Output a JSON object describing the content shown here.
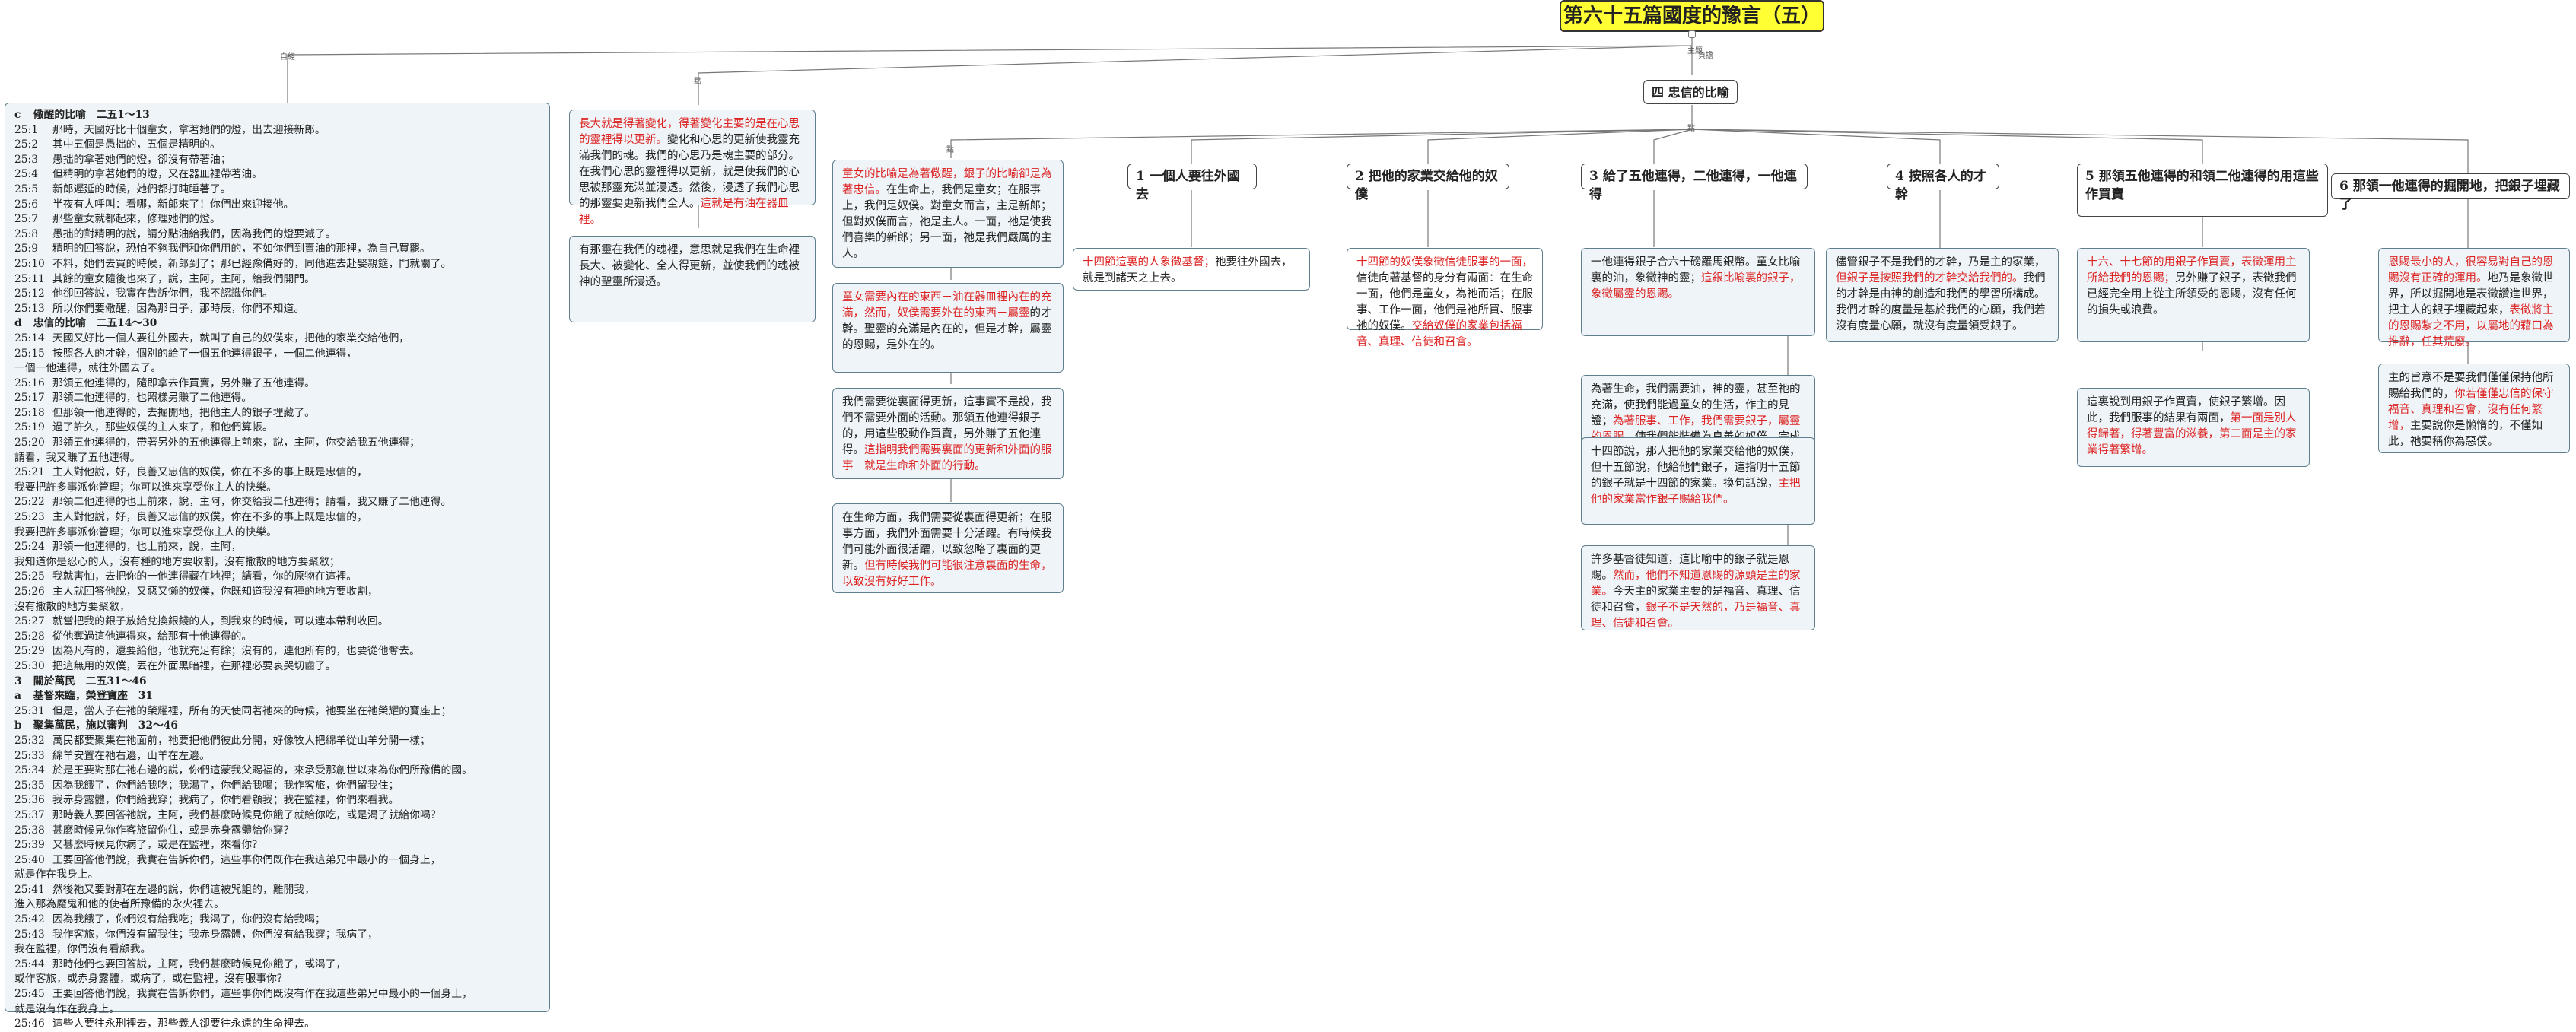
{
  "root": {
    "title": "第六十五篇國度的豫言（五）"
  },
  "labels": {
    "top_connector": "主題",
    "left_branch": "自經",
    "mid_branch": "點",
    "right_branch": "負擔",
    "sub_branch": "點",
    "item_point": "點"
  },
  "scripture": {
    "lines": [
      {
        "t": "h",
        "ref": "c",
        "text": "  儆醒的比喻　二五1～13"
      },
      {
        "t": "v",
        "ref": "25:1",
        "text": "那時，天國好比十個童女，拿著她們的燈，出去迎接新郎。"
      },
      {
        "t": "v",
        "ref": "25:2",
        "text": "其中五個是愚拙的，五個是精明的。"
      },
      {
        "t": "v",
        "ref": "25:3",
        "text": "愚拙的拿著她們的燈，卻沒有帶著油；"
      },
      {
        "t": "v",
        "ref": "25:4",
        "text": "但精明的拿著她們的燈，又在器皿裡帶著油。"
      },
      {
        "t": "v",
        "ref": "25:5",
        "text": "新郎遲延的時候，她們都打盹睡著了。"
      },
      {
        "t": "v",
        "ref": "25:6",
        "text": "半夜有人呼叫：看哪，新郎來了！你們出來迎接他。"
      },
      {
        "t": "v",
        "ref": "25:7",
        "text": "那些童女就都起來，修理她們的燈。"
      },
      {
        "t": "v",
        "ref": "25:8",
        "text": "愚拙的對精明的說，請分點油給我們，因為我們的燈要滅了。"
      },
      {
        "t": "v",
        "ref": "25:9",
        "text": "精明的回答說，恐怕不夠我們和你們用的，不如你們到賣油的那裡，為自己買罷。"
      },
      {
        "t": "v",
        "ref": "25:10",
        "text": "不料，她們去買的時候，新郎到了；那已經豫備好的，同他進去赴娶親筵，門就關了。"
      },
      {
        "t": "v",
        "ref": "25:11",
        "text": "其餘的童女隨後也來了，說，主阿，主阿，給我們開門。"
      },
      {
        "t": "v",
        "ref": "25:12",
        "text": "他卻回答說，我實在告訴你們，我不認識你們。"
      },
      {
        "t": "v",
        "ref": "25:13",
        "text": "所以你們要儆醒，因為那日子，那時辰，你們不知道。"
      },
      {
        "t": "h",
        "ref": "d",
        "text": "  忠信的比喻　二五14～30"
      },
      {
        "t": "v",
        "ref": "25:14",
        "text": "天國又好比一個人要往外國去，就叫了自己的奴僕來，把他的家業交給他們，"
      },
      {
        "t": "v",
        "ref": "25:15",
        "text": "按照各人的才幹，個別的給了一個五他連得銀子，一個二他連得，"
      },
      {
        "t": "c",
        "ref": "",
        "text": "一個一他連得，就往外國去了。"
      },
      {
        "t": "v",
        "ref": "25:16",
        "text": "那領五他連得的，隨即拿去作買賣，另外賺了五他連得。"
      },
      {
        "t": "v",
        "ref": "25:17",
        "text": "那領二他連得的，也照樣另賺了二他連得。"
      },
      {
        "t": "v",
        "ref": "25:18",
        "text": "但那領一他連得的，去掘開地，把他主人的銀子埋藏了。"
      },
      {
        "t": "v",
        "ref": "25:19",
        "text": "過了許久，那些奴僕的主人來了，和他們算帳。"
      },
      {
        "t": "v",
        "ref": "25:20",
        "text": "那領五他連得的，帶著另外的五他連得上前來，說，主阿，你交給我五他連得；"
      },
      {
        "t": "c",
        "ref": "",
        "text": "請看，我又賺了五他連得。"
      },
      {
        "t": "v",
        "ref": "25:21",
        "text": "主人對他說，好，良善又忠信的奴僕，你在不多的事上既是忠信的，"
      },
      {
        "t": "c",
        "ref": "",
        "text": "我要把許多事派你管理；你可以進來享受你主人的快樂。"
      },
      {
        "t": "v",
        "ref": "25:22",
        "text": "那領二他連得的也上前來，說，主阿，你交給我二他連得；請看，我又賺了二他連得。"
      },
      {
        "t": "v",
        "ref": "25:23",
        "text": "主人對他說，好，良善又忠信的奴僕，你在不多的事上既是忠信的，"
      },
      {
        "t": "c",
        "ref": "",
        "text": "我要把許多事派你管理；你可以進來享受你主人的快樂。"
      },
      {
        "t": "v",
        "ref": "25:24",
        "text": "那領一他連得的，也上前來，說，主阿，"
      },
      {
        "t": "c",
        "ref": "",
        "text": "我知道你是忍心的人，沒有種的地方要收割，沒有撒散的地方要聚斂；"
      },
      {
        "t": "v",
        "ref": "25:25",
        "text": "我就害怕，去把你的一他連得藏在地裡；請看，你的原物在這裡。"
      },
      {
        "t": "v",
        "ref": "25:26",
        "text": "主人就回答他說，又惡又懶的奴僕，你既知道我沒有種的地方要收割，"
      },
      {
        "t": "c",
        "ref": "",
        "text": "沒有撒散的地方要聚斂，"
      },
      {
        "t": "v",
        "ref": "25:27",
        "text": "就當把我的銀子放給兌換銀錢的人，到我來的時候，可以連本帶利收回。"
      },
      {
        "t": "v",
        "ref": "25:28",
        "text": "從他奪過這他連得來，給那有十他連得的。"
      },
      {
        "t": "v",
        "ref": "25:29",
        "text": "因為凡有的，還要給他，他就充足有餘；沒有的，連他所有的，也要從他奪去。"
      },
      {
        "t": "v",
        "ref": "25:30",
        "text": "把這無用的奴僕，丟在外面黑暗裡，在那裡必要哀哭切齒了。"
      },
      {
        "t": "h",
        "ref": "3",
        "text": "  關於萬民　二五31～46"
      },
      {
        "t": "h",
        "ref": "a",
        "text": "  基督來臨，榮登寶座　31"
      },
      {
        "t": "v",
        "ref": "25:31",
        "text": "但是，當人子在祂的榮耀裡，所有的天使同著祂來的時候，祂要坐在祂榮耀的寶座上；"
      },
      {
        "t": "h",
        "ref": "b",
        "text": "  聚集萬民，施以審判　32～46"
      },
      {
        "t": "v",
        "ref": "25:32",
        "text": "萬民都要聚集在祂面前，祂要把他們彼此分開，好像牧人把綿羊從山羊分開一樣；"
      },
      {
        "t": "v",
        "ref": "25:33",
        "text": "綿羊安置在祂右邊，山羊在左邊。"
      },
      {
        "t": "v",
        "ref": "25:34",
        "text": "於是王要對那在祂右邊的說，你們這蒙我父賜福的，來承受那創世以來為你們所豫備的國。"
      },
      {
        "t": "v",
        "ref": "25:35",
        "text": "因為我餓了，你們給我吃；我渴了，你們給我喝；我作客旅，你們留我住；"
      },
      {
        "t": "v",
        "ref": "25:36",
        "text": "我赤身露體，你們給我穿；我病了，你們看顧我；我在監裡，你們來看我。"
      },
      {
        "t": "v",
        "ref": "25:37",
        "text": "那時義人要回答祂說，主阿，我們甚麼時候見你餓了就給你吃，或是渴了就給你喝？"
      },
      {
        "t": "v",
        "ref": "25:38",
        "text": "甚麼時候見你作客旅留你住，或是赤身露體給你穿？"
      },
      {
        "t": "v",
        "ref": "25:39",
        "text": "又甚麼時候見你病了，或是在監裡，來看你？"
      },
      {
        "t": "v",
        "ref": "25:40",
        "text": "王要回答他們說，我實在告訴你們，這些事你們既作在我這弟兄中最小的一個身上，"
      },
      {
        "t": "c",
        "ref": "",
        "text": "就是作在我身上。"
      },
      {
        "t": "v",
        "ref": "25:41",
        "text": "然後祂又要對那在左邊的說，你們這被咒詛的，離開我，"
      },
      {
        "t": "c",
        "ref": "",
        "text": "進入那為魔鬼和他的使者所豫備的永火裡去。"
      },
      {
        "t": "v",
        "ref": "25:42",
        "text": "因為我餓了，你們沒有給我吃；我渴了，你們沒有給我喝；"
      },
      {
        "t": "v",
        "ref": "25:43",
        "text": "我作客旅，你們沒有留我住；我赤身露體，你們沒有給我穿；我病了，"
      },
      {
        "t": "c",
        "ref": "",
        "text": "我在監裡，你們沒有看顧我。"
      },
      {
        "t": "v",
        "ref": "25:44",
        "text": "那時他們也要回答說，主阿，我們甚麼時候見你餓了，或渴了，"
      },
      {
        "t": "c",
        "ref": "",
        "text": "或作客旅，或赤身露體，或病了，或在監裡，沒有服事你？"
      },
      {
        "t": "v",
        "ref": "25:45",
        "text": "王要回答他們說，我實在告訴你們，這些事你們既沒有作在我這些弟兄中最小的一個身上，"
      },
      {
        "t": "c",
        "ref": "",
        "text": "就是沒有作在我身上。"
      },
      {
        "t": "v",
        "ref": "25:46",
        "text": "這些人要往永刑裡去，那些義人卻要往永遠的生命裡去。"
      }
    ]
  },
  "middle": {
    "top_a": "長大就是得著變化，得著變化主要的是在心思的靈裡得以更新。",
    "top_b": "變化和心思的更新使我靈充滿我們的魂。我們的心思乃是魂主要的部分。在我們心思的靈裡得以更新，就是使我們的心思被那靈充滿並浸透。然後，浸透了我們心思的那靈要更新我們全人。",
    "top_c": "這就是有油在器皿裡。",
    "second": "有那靈在我們的魂裡，意思就是我們在生命裡長大、被變化、全人得更新，並使我們的魂被神的聖靈所浸透。"
  },
  "center_branch": {
    "title": "四 忠信的比喻",
    "parable_a_red": "童女的比喻是為著儆醒，銀子的比喻卻是為著忠信。",
    "parable_a": "在生命上，我們是童女；在服事上，我們是奴僕。對童女而言，主是新郎；但對奴僕而言，祂是主人。一面，祂是使我們喜樂的新郎；另一面，祂是我們嚴厲的主人。",
    "oil_a_red": "童女需要內在的東西－油在器皿裡內在的充滿，然而，",
    "oil_b_red": "奴僕需要外在的東西－屬靈",
    "oil_c": "的才幹。聖靈的充滿是內在的，但是才幹，屬靈的恩賜，是外在的。",
    "renew_a": "我們需要從裏面得更新，這事實不是說，我們不需要外面的活動。那領五他連得銀子的，用這些股動作買賣，另外賺了五他連得。",
    "renew_red": "這指明我們需要裏面的更新和外面的服事－就是生命和外面的行動。",
    "life_a": "在生命方面，我們需要從裏面得更新；在服事方面，我們外面需要十分活躍。有時候我們可能外面很活躍，以致忽略了裏面的更新。",
    "life_red": "但有時候我們可能很注意裏面的生命，以致沒有好好工作。"
  },
  "items": [
    {
      "title": "1 一個人要往外國去",
      "body_red": "十四節這裏的人象徵基督；",
      "body": "祂要往外國去，就是到諸天之上去。"
    },
    {
      "title": "2 把他的家業交給他的奴僕",
      "body_red": "十四節的奴僕象徵信徒服事的一面，",
      "body": "信徒向著基督的身分有兩面：在生命一面，他們是童女，為祂而活；在服事、工作一面，他們是祂所買、服事祂的奴僕。",
      "body_red2": "交給奴僕的家業包括福音、真理、信徒和召會。"
    },
    {
      "title": "3 給了五他連得，二他連得，一他連得",
      "p1": "一他連得銀子合六十磅羅馬銀幣。童女比喻裏的油，象徵神的靈；",
      "p1_red": "這銀比喻裏的銀子，象徵屬靈的恩賜。",
      "p2": "為著生命，我們需要油，神的靈，甚至祂的充滿，使我們能過童女的生活，作主的見證；",
      "p2_red": "為著服事、工作，我們需要銀子，屬靈的恩賜，",
      "p2b": "使我們能裝備為良善的奴僕，完成主的工作。",
      "p3": "十四節說，那人把他的家業交給他的奴僕，但十五節說，他給他們銀子，這指明十五節的銀子就是十四節的家業。換句話說，",
      "p3_red": "主把他的家業當作銀子賜給我們。",
      "p4": "許多基督徒知道，這比喻中的銀子就是恩賜。",
      "p4_red": "然而，他們不知道恩賜的源頭是主的家業。",
      "p4b": "今天主的家業主要的是福音、真理、信徒和召會，",
      "p4_red2": "銀子不是天然的，乃是福音、真理、信徒和召會。"
    },
    {
      "title": "4 按照各人的才幹",
      "body": "儘管銀子不是我們的才幹，乃是主的家業，",
      "body_red": "但銀子是按照我們的才幹交給我們的。",
      "body2": "我們的才幹是由神的創造和我們的學習所構成。我們才幹的度量是基於我們的心願，我們若沒有度量心願，就沒有度量領受銀子。"
    },
    {
      "title": "5 那領五他連得的和領二他連得的用這些作買賣",
      "body_red": "十六、十七節的用銀子作買賣，表徵運用主所給我們的恩賜；",
      "body": "另外賺了銀子，表徵我們已經完全用上從主所領受的恩賜，沒有任何的損失或浪費。",
      "body2": "這裏說到用銀子作買賣，使銀子繁增。因此，我們服事的結果有兩面，",
      "body2_red": "第一面是別人得歸著，得著豐富的滋養，第二面是主的家業得著繁增。"
    },
    {
      "title": "6 那領一他連得的掘開地，把銀子埋藏了",
      "body_red": "恩賜最小的人，很容易對自己的恩賜沒有正確的運用。",
      "body": "地乃是象徵世界，所以掘開地是表徵讚進世界，把主人的銀子埋藏起來，",
      "body_red2": "表徵將主的恩賜紮之不用，以屬地的藉口為推辭，任其荒廢。",
      "body2": "主的旨意不是要我們僅僅保持他所賜給我們的，",
      "body2_red": "你若僅僅忠信的保守福音、真理和召會，沒有任何繁增，",
      "body2b": "主要說你是懶惰的，不僅如此，祂要稱你為惡僕。"
    }
  ]
}
